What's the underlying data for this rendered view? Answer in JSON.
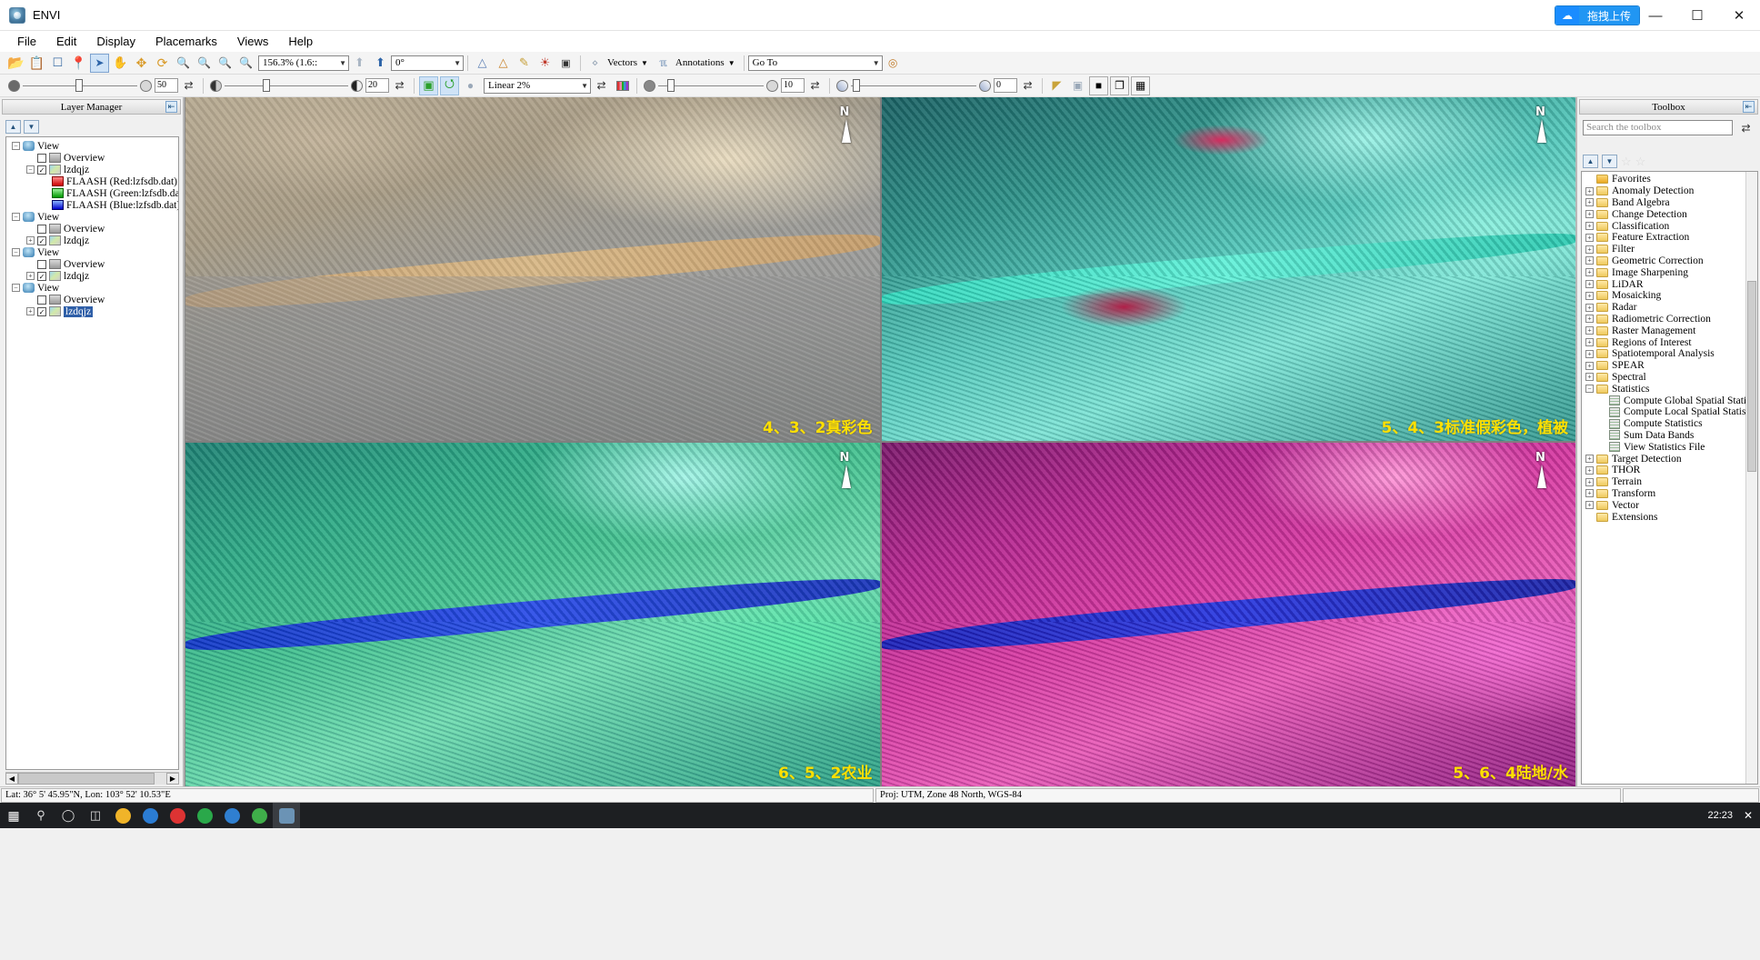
{
  "window": {
    "title": "ENVI",
    "app_icon": "envi-globe-icon",
    "minimize": "—",
    "maximize": "☐",
    "close": "✕",
    "upload_badge": {
      "icon": "cloud-upload-icon",
      "label": "拖拽上传"
    }
  },
  "menubar": {
    "items": [
      "File",
      "Edit",
      "Display",
      "Placemarks",
      "Views",
      "Help"
    ]
  },
  "toolbar_main": {
    "icons": [
      {
        "name": "open-file-icon",
        "glyph": "📂",
        "color": "#e8ab22"
      },
      {
        "name": "paste-clipboard-icon",
        "glyph": "📋",
        "color": "#7b8796"
      },
      {
        "name": "crop-image-icon",
        "glyph": "❐",
        "color": "#3c6ea5"
      },
      {
        "name": "placemark-pin-icon",
        "glyph": "📍",
        "color": "#cf2b2b"
      },
      {
        "name": "select-pointer-icon",
        "glyph": "➤",
        "color": "#2d64a8",
        "selected": true
      },
      {
        "name": "pan-hand-icon",
        "glyph": "✋",
        "color": "#d99a28"
      },
      {
        "name": "fly-navigate-icon",
        "glyph": "✥",
        "color": "#d99a28"
      },
      {
        "name": "rotate-icon",
        "glyph": "⟳",
        "color": "#d99a28"
      },
      {
        "name": "zoom-to-fit-icon",
        "glyph": "🔍",
        "color": "#6f8fb5"
      },
      {
        "name": "zoom-in-icon",
        "glyph": "🔍",
        "color": "#6f8fb5"
      },
      {
        "name": "zoom-out-icon",
        "glyph": "🔍",
        "color": "#6f8fb5"
      },
      {
        "name": "zoom-selection-icon",
        "glyph": "🔍",
        "color": "#9aa8b8"
      }
    ],
    "zoom_value": "156.3% (1.6::",
    "snapshot_icon": "snapshot-up-icon",
    "north_icon": "north-rotate-icon",
    "rotation_value": "0°",
    "icons2": [
      {
        "name": "spectral-profile-icon",
        "glyph": "☳",
        "color": "#5b7fb5"
      },
      {
        "name": "multi-spectral-profile-icon",
        "glyph": "☳",
        "color": "#c9822a"
      },
      {
        "name": "measure-tool-icon",
        "glyph": "✐",
        "color": "#c7a03a"
      },
      {
        "name": "roi-tool-icon",
        "glyph": "◰",
        "color": "#c0392b"
      },
      {
        "name": "cursor-value-icon",
        "glyph": "⬚",
        "color": "#333333"
      }
    ],
    "vectors_label": "Vectors",
    "vectors_icon": "vectors-icon",
    "annotations_label": "Annotations",
    "annotations_icon": "annotations-icon",
    "goto_value": "Go To",
    "goto_btn_icon": "goto-target-icon"
  },
  "toolbar_second": {
    "transparency_value": "50",
    "transparency_left_icon": "opaque-circle-icon",
    "transparency_right_icon": "transparent-circle-icon",
    "transparency_reset_icon": "reset-icon",
    "brightness_value": "20",
    "brightness_left_icon": "brightness-dark-icon",
    "brightness_right_icon": "brightness-half-icon",
    "brightness_reset_icon": "reset-icon",
    "crop_icons": [
      "crop-green-icon",
      "rotate-green-icon",
      "blur-gray-icon"
    ],
    "stretch_value": "Linear 2%",
    "stretch_refresh_icon": "reset-icon",
    "histogram_icon": "histogram-color-icon",
    "contrast_value": "10",
    "contrast_reset_icon": "reset-icon",
    "sharpen_value": "0",
    "sharpen_reset_icon": "reset-icon",
    "right_icons": [
      "ruler-icon",
      "portal-icon",
      "view-single-icon",
      "view-stack-icon",
      "view-grid-icon"
    ]
  },
  "layer_manager": {
    "title": "Layer Manager",
    "pin_icon": "pin-panel-icon",
    "up_icon": "move-up-icon",
    "down_icon": "move-down-icon",
    "tree": [
      {
        "depth": 0,
        "expander": "−",
        "icon": "view-icon",
        "label": "View",
        "check": null
      },
      {
        "depth": 1,
        "expander": null,
        "icon": "overview-icon",
        "label": "Overview",
        "check": false
      },
      {
        "depth": 1,
        "expander": "−",
        "icon": "raster-icon",
        "label": "lzdqjz",
        "check": true
      },
      {
        "depth": 2,
        "expander": null,
        "icon": "band-red-icon",
        "label": "FLAASH (Red:lzfsdb.dat) (",
        "check": null
      },
      {
        "depth": 2,
        "expander": null,
        "icon": "band-green-icon",
        "label": "FLAASH (Green:lzfsdb.dat)",
        "check": null
      },
      {
        "depth": 2,
        "expander": null,
        "icon": "band-blue-icon",
        "label": "FLAASH (Blue:lzfsdb.dat)",
        "check": null
      },
      {
        "depth": 0,
        "expander": "−",
        "icon": "view-icon",
        "label": "View",
        "check": null
      },
      {
        "depth": 1,
        "expander": null,
        "icon": "overview-icon",
        "label": "Overview",
        "check": false
      },
      {
        "depth": 1,
        "expander": "+",
        "icon": "raster-icon",
        "label": "lzdqjz",
        "check": true
      },
      {
        "depth": 0,
        "expander": "−",
        "icon": "view-icon",
        "label": "View",
        "check": null
      },
      {
        "depth": 1,
        "expander": null,
        "icon": "overview-icon",
        "label": "Overview",
        "check": false
      },
      {
        "depth": 1,
        "expander": "+",
        "icon": "raster-icon",
        "label": "lzdqjz",
        "check": true
      },
      {
        "depth": 0,
        "expander": "−",
        "icon": "view-icon",
        "label": "View",
        "check": null
      },
      {
        "depth": 1,
        "expander": null,
        "icon": "overview-icon",
        "label": "Overview",
        "check": false
      },
      {
        "depth": 1,
        "expander": "+",
        "icon": "raster-icon",
        "label": "lzdqjz",
        "check": true,
        "selected": true
      }
    ],
    "scroll_left_icon": "scroll-left-icon",
    "scroll_right_icon": "scroll-right-icon"
  },
  "toolbox": {
    "title": "Toolbox",
    "pin_icon": "pin-panel-icon",
    "search_placeholder": "Search the toolbox",
    "search_value": "",
    "refresh_icon": "refresh-icon",
    "up_icon": "move-up-icon",
    "down_icon": "move-down-icon",
    "star_icons": [
      "add-favorite-icon",
      "remove-favorite-icon"
    ],
    "tree": [
      {
        "depth": 0,
        "expander": null,
        "type": "folder-fav",
        "label": "Favorites"
      },
      {
        "depth": 0,
        "expander": "+",
        "type": "folder",
        "label": "Anomaly Detection"
      },
      {
        "depth": 0,
        "expander": "+",
        "type": "folder",
        "label": "Band Algebra"
      },
      {
        "depth": 0,
        "expander": "+",
        "type": "folder",
        "label": "Change Detection"
      },
      {
        "depth": 0,
        "expander": "+",
        "type": "folder",
        "label": "Classification"
      },
      {
        "depth": 0,
        "expander": "+",
        "type": "folder",
        "label": "Feature Extraction"
      },
      {
        "depth": 0,
        "expander": "+",
        "type": "folder",
        "label": "Filter"
      },
      {
        "depth": 0,
        "expander": "+",
        "type": "folder",
        "label": "Geometric Correction"
      },
      {
        "depth": 0,
        "expander": "+",
        "type": "folder",
        "label": "Image Sharpening"
      },
      {
        "depth": 0,
        "expander": "+",
        "type": "folder",
        "label": "LiDAR"
      },
      {
        "depth": 0,
        "expander": "+",
        "type": "folder",
        "label": "Mosaicking"
      },
      {
        "depth": 0,
        "expander": "+",
        "type": "folder",
        "label": "Radar"
      },
      {
        "depth": 0,
        "expander": "+",
        "type": "folder",
        "label": "Radiometric Correction"
      },
      {
        "depth": 0,
        "expander": "+",
        "type": "folder",
        "label": "Raster Management"
      },
      {
        "depth": 0,
        "expander": "+",
        "type": "folder",
        "label": "Regions of Interest"
      },
      {
        "depth": 0,
        "expander": "+",
        "type": "folder",
        "label": "Spatiotemporal Analysis"
      },
      {
        "depth": 0,
        "expander": "+",
        "type": "folder",
        "label": "SPEAR"
      },
      {
        "depth": 0,
        "expander": "+",
        "type": "folder",
        "label": "Spectral"
      },
      {
        "depth": 0,
        "expander": "−",
        "type": "folder",
        "label": "Statistics"
      },
      {
        "depth": 1,
        "expander": null,
        "type": "leaf",
        "label": "Compute Global Spatial Stati"
      },
      {
        "depth": 1,
        "expander": null,
        "type": "leaf",
        "label": "Compute Local Spatial Statis"
      },
      {
        "depth": 1,
        "expander": null,
        "type": "leaf",
        "label": "Compute Statistics"
      },
      {
        "depth": 1,
        "expander": null,
        "type": "leaf",
        "label": "Sum Data Bands"
      },
      {
        "depth": 1,
        "expander": null,
        "type": "leaf",
        "label": "View Statistics File"
      },
      {
        "depth": 0,
        "expander": "+",
        "type": "folder",
        "label": "Target Detection"
      },
      {
        "depth": 0,
        "expander": "+",
        "type": "folder",
        "label": "THOR"
      },
      {
        "depth": 0,
        "expander": "+",
        "type": "folder",
        "label": "Terrain"
      },
      {
        "depth": 0,
        "expander": "+",
        "type": "folder",
        "label": "Transform"
      },
      {
        "depth": 0,
        "expander": "+",
        "type": "folder",
        "label": "Vector"
      },
      {
        "depth": 0,
        "expander": null,
        "type": "folder",
        "label": "Extensions"
      }
    ]
  },
  "viewports": [
    {
      "name": "viewport-true-color",
      "label": "4、3、2真彩色",
      "north_letter": "N"
    },
    {
      "name": "viewport-false-color-vegetation",
      "label": "5、4、3标准假彩色，植被",
      "north_letter": "N"
    },
    {
      "name": "viewport-agriculture",
      "label": "6、5、2农业",
      "north_letter": "N"
    },
    {
      "name": "viewport-land-water",
      "label": "5、6、4陆地/水",
      "north_letter": "N"
    }
  ],
  "statusbar": {
    "coordinates": "Lat: 36° 5' 45.95\"N,  Lon: 103° 52' 10.53\"E",
    "projection": "Proj: UTM, Zone 48 North, WGS-84",
    "extra": ""
  },
  "taskbar": {
    "clock": "22:23",
    "close_icon": "close-icon",
    "apps": [
      {
        "name": "start-button",
        "color": "#ffffff"
      },
      {
        "name": "search-icon",
        "color": "#dcdcdc"
      },
      {
        "name": "cortana-icon",
        "color": "#dcdcdc"
      },
      {
        "name": "task-view-icon",
        "color": "#dcdcdc"
      },
      {
        "name": "file-explorer-icon",
        "color": "#f0b429"
      },
      {
        "name": "edge-icon",
        "color": "#2b7cd3"
      },
      {
        "name": "pdf-reader-icon",
        "color": "#d33"
      },
      {
        "name": "wps-icon",
        "color": "#2aa84a"
      },
      {
        "name": "browser-icon",
        "color": "#2f7fd0"
      },
      {
        "name": "chrome-icon",
        "color": "#3fae4a"
      },
      {
        "name": "envi-icon",
        "color": "#6b93b5"
      }
    ]
  },
  "colors": {
    "accent": "#2196f3",
    "annotation_yellow": "#ffe000",
    "selection_blue": "#2f5fa8"
  }
}
